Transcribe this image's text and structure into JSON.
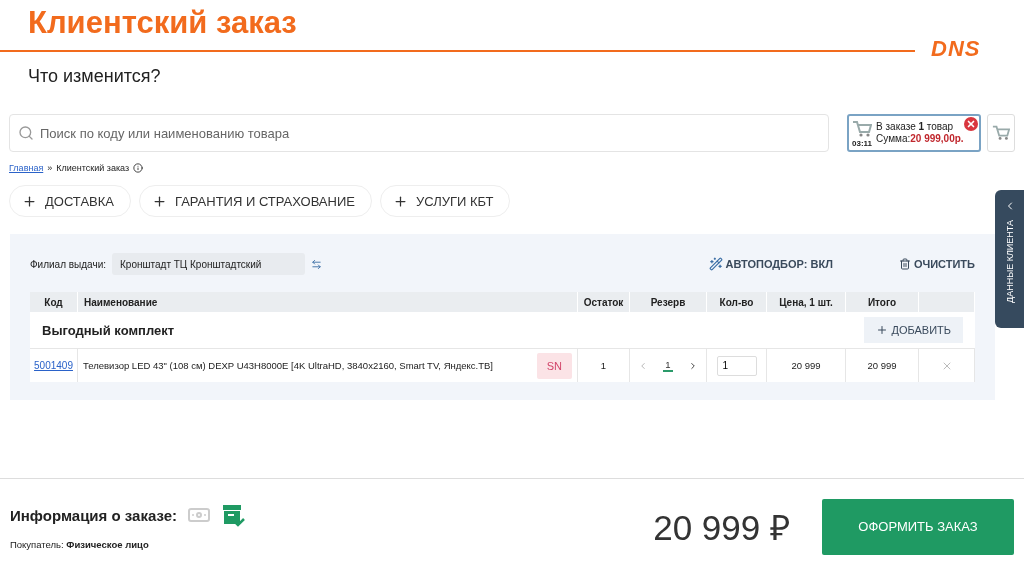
{
  "slide": {
    "title": "Клиентский заказ",
    "subtitle": "Что изменится?",
    "logo": "DNS"
  },
  "search": {
    "placeholder": "Поиск по коду или наименованию товара"
  },
  "cart_widget": {
    "timer": "03:11",
    "summary": "В заказе **1** товар",
    "sum_label": "Сумма:",
    "sum": "20 999,00р."
  },
  "breadcrumbs": [
    {
      "label": "Главная",
      "link": true
    },
    {
      "label": "»",
      "link": false
    },
    {
      "label": "Клиентский заказ",
      "link": false
    }
  ],
  "service_buttons": [
    "ДОСТАВКА",
    "ГАРАНТИЯ И СТРАХОВАНИЕ",
    "УСЛУГИ КБТ"
  ],
  "side_tab": "ДАННЫЕ КЛИЕНТА",
  "order": {
    "branch_label": "Филиал выдачи:",
    "branch_value": "Кронштадт ТЦ Кронштадтский",
    "autopick": "АВТОПОДБОР: ВКЛ",
    "clear": "ОЧИСТИТЬ",
    "columns": [
      "Код",
      "Наименование",
      "Остаток",
      "Резерв",
      "Кол-во",
      "Цена, 1 шт.",
      "Итого"
    ],
    "group": {
      "title": "Выгодный комплект",
      "add": "ДОБАВИТЬ"
    },
    "rows": [
      {
        "code": "5001409",
        "name": "Телевизор LED 43\" (108 см) DEXP U43H8000E [4K UltraHD, 3840x2160, Smart TV, Яндекс.ТВ]",
        "badge": "SN",
        "stock": "1",
        "reserve": "1",
        "qty": "1",
        "price": "20 999",
        "total": "20 999"
      }
    ]
  },
  "footer": {
    "info_label": "Информация о заказе:",
    "buyer_label": "Покупатель:",
    "buyer": "Физическое лицо",
    "total": "20 999 ₽",
    "checkout": "ОФОРМИТЬ ЗАКАЗ"
  }
}
